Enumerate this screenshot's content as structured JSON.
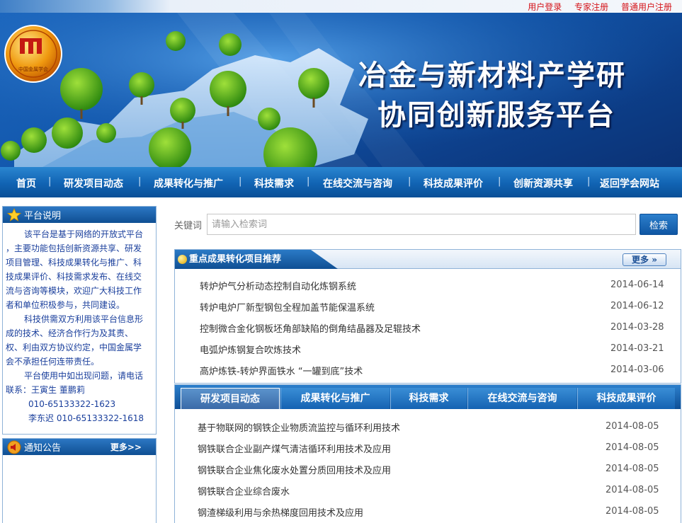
{
  "top_links": [
    "用户登录",
    "专家注册",
    "普通用户注册"
  ],
  "logo_text": "中国金属学会",
  "banner": {
    "title_line1": "冶金与新材料产学研",
    "title_line2": "协同创新服务平台"
  },
  "nav": [
    "首页",
    "研发项目动态",
    "成果转化与推广",
    "科技需求",
    "在线交流与咨询",
    "科技成果评价",
    "创新资源共享",
    "返回学会网站"
  ],
  "platform": {
    "title": "平台说明",
    "lines": [
      "该平台是基于网络的开放式平台",
      "，主要功能包括创新资源共享、研发",
      "项目管理、科技成果转化与推广、科",
      "技成果评价、科技需求发布、在线交",
      "流与咨询等模块，欢迎广大科技工作",
      "者和单位积极参与，共同建设。",
      "科技供需双方利用该平台信息形",
      "成的技术、经济合作行为及其责、",
      "权、利由双方协议约定，中国金属学",
      "会不承担任何连带责任。",
      "平台使用中如出现问题，请电话",
      "联系：王寅生 董鹏莉",
      "010-65133322-1623",
      "李东迟 010-65133322-1618"
    ]
  },
  "notice": {
    "title": "通知公告",
    "more": "更多>>"
  },
  "search": {
    "label": "关键词",
    "placeholder": "请输入检索词",
    "button": "检索"
  },
  "featured": {
    "title": "重点成果转化项目推荐",
    "more": "更多",
    "items": [
      {
        "title": "转炉炉气分析动态控制自动化炼钢系统",
        "date": "2014-06-14"
      },
      {
        "title": "转炉电炉厂新型钢包全程加盖节能保温系统",
        "date": "2014-06-12"
      },
      {
        "title": "控制微合金化钢板坯角部缺陷的倒角结晶器及足辊技术",
        "date": "2014-03-28"
      },
      {
        "title": "电弧炉炼钢复合吹炼技术",
        "date": "2014-03-21"
      },
      {
        "title": "高炉炼铁-转炉界面铁水 “一罐到底”技术",
        "date": "2014-03-06"
      }
    ]
  },
  "tabs": {
    "labels": [
      "研发项目动态",
      "成果转化与推广",
      "科技需求",
      "在线交流与咨询",
      "科技成果评价"
    ],
    "active": "研发项目动态",
    "items": [
      {
        "title": "基于物联网的钢铁企业物质流监控与循环利用技术",
        "date": "2014-08-05"
      },
      {
        "title": "钢铁联合企业副产煤气清洁循环利用技术及应用",
        "date": "2014-08-05"
      },
      {
        "title": "钢铁联合企业焦化废水处置分质回用技术及应用",
        "date": "2014-08-05"
      },
      {
        "title": "钢铁联合企业综合废水",
        "date": "2014-08-05"
      },
      {
        "title": "钢渣梯级利用与余热梯度回用技术及应用",
        "date": "2014-08-05"
      }
    ]
  }
}
